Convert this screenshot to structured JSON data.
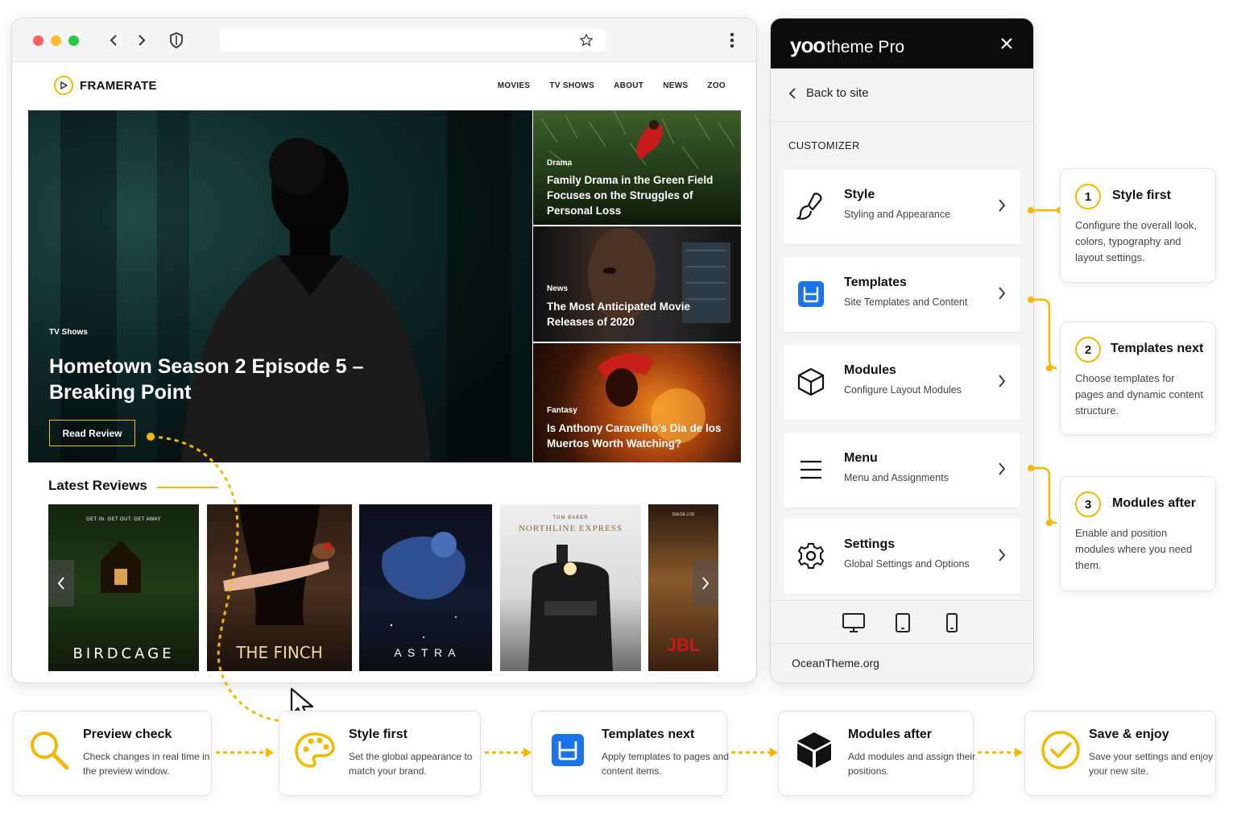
{
  "browser": {
    "site_logo": "FRAMERATE",
    "nav": [
      "MOVIES",
      "TV SHOWS",
      "ABOUT",
      "NEWS",
      "ZOO"
    ],
    "hero": {
      "tag": "TV Shows",
      "title": "Hometown Season 2 Episode 5 – Breaking Point",
      "button": "Read Review"
    },
    "side_cards": [
      {
        "tag": "Drama",
        "title": "Family Drama in the Green Field Focuses on the Struggles of Personal Loss"
      },
      {
        "tag": "News",
        "title": "The Most Anticipated Movie Releases of 2020"
      },
      {
        "tag": "Fantasy",
        "title": "Is Anthony Caravelho's Dia de los Muertos Worth Watching?"
      }
    ],
    "latest_reviews": "Latest Reviews",
    "posters": [
      {
        "tagline": "GET IN. GET OUT. GET AWAY",
        "title": "BIRDCAGE"
      },
      {
        "title": "THE FINCH"
      },
      {
        "title": "A S T R A"
      },
      {
        "subtitle": "TOM BAKER",
        "title": "NORTHLINE EXPRESS"
      },
      {
        "tagline": "DIA DE LOS",
        "title": "JBL"
      }
    ]
  },
  "customizer": {
    "brand_yoo": "yoo",
    "brand_rest": "theme Pro",
    "back": "Back to site",
    "section_label": "CUSTOMIZER",
    "items": [
      {
        "title": "Style",
        "sub": "Styling and Appearance",
        "icon": "brush-icon"
      },
      {
        "title": "Templates",
        "sub": "Site Templates and Content",
        "icon": "templates-icon"
      },
      {
        "title": "Modules",
        "sub": "Configure Layout Modules",
        "icon": "cube-icon"
      },
      {
        "title": "Menu",
        "sub": "Menu and Assignments",
        "icon": "menu-icon"
      },
      {
        "title": "Settings",
        "sub": "Global Settings and Options",
        "icon": "gear-icon"
      }
    ],
    "footer": "OceanTheme.org"
  },
  "steps": [
    {
      "num": "1",
      "title": "Style first",
      "desc": "Configure the overall look, colors, typography and layout settings."
    },
    {
      "num": "2",
      "title": "Templates next",
      "desc": "Choose templates for pages and dynamic content structure."
    },
    {
      "num": "3",
      "title": "Modules after",
      "desc": "Enable and position modules where you need them."
    }
  ],
  "flow": [
    {
      "title": "Preview check",
      "desc": "Check changes in real time in the preview window."
    },
    {
      "title": "Style first",
      "desc": "Set the global appearance to match your brand."
    },
    {
      "title": "Templates next",
      "desc": "Apply templates to pages and content items."
    },
    {
      "title": "Modules after",
      "desc": "Add modules and assign their positions."
    },
    {
      "title": "Save & enjoy",
      "desc": "Save your settings and enjoy your new site."
    }
  ],
  "colors": {
    "accent": "#f5b800",
    "blue": "#1a73e8",
    "dark": "#0c0c0c"
  }
}
